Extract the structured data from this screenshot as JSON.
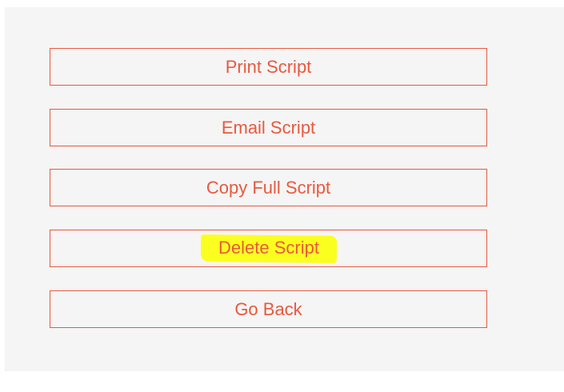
{
  "menu": {
    "buttons": [
      {
        "label": "Print Script"
      },
      {
        "label": "Email Script"
      },
      {
        "label": "Copy Full Script"
      },
      {
        "label": "Delete Script",
        "highlighted": true
      },
      {
        "label": "Go Back"
      }
    ]
  },
  "colors": {
    "accent": "#e8593f",
    "panel_background": "#f5f5f5",
    "highlight": "#fbff1f"
  }
}
